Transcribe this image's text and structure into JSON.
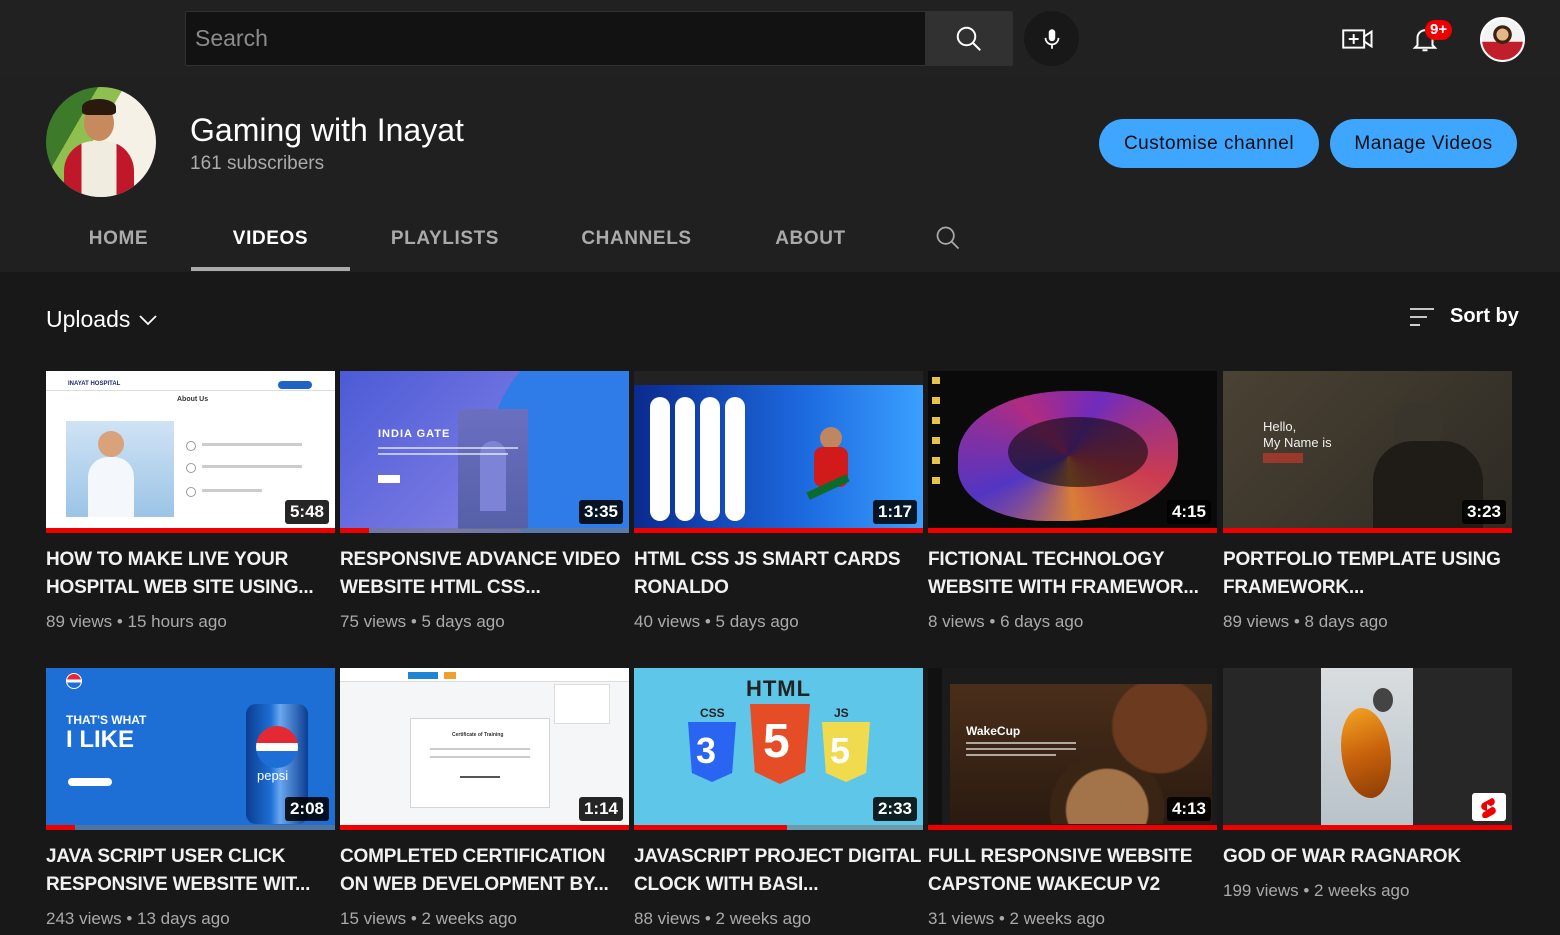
{
  "topbar": {
    "search_placeholder": "Search",
    "notification_count": "9+"
  },
  "channel": {
    "name": "Gaming with Inayat",
    "subscribers": "161 subscribers",
    "customise_label": "Customise channel",
    "manage_label": "Manage Videos"
  },
  "tabs": [
    "HOME",
    "VIDEOS",
    "PLAYLISTS",
    "CHANNELS",
    "ABOUT"
  ],
  "section": {
    "uploads_label": "Uploads",
    "sort_label": "Sort by"
  },
  "videos": [
    {
      "title": "HOW TO MAKE LIVE YOUR HOSPITAL WEB SITE USING...",
      "views": "89 views",
      "ago": "15 hours ago",
      "duration": "5:48",
      "watched": 1.0
    },
    {
      "title": "RESPONSIVE ADVANCE VIDEO WEBSITE HTML CSS...",
      "views": "75 views",
      "ago": "5 days ago",
      "duration": "3:35",
      "watched": 0.1
    },
    {
      "title": "HTML CSS JS SMART CARDS RONALDO",
      "views": "40 views",
      "ago": "5 days ago",
      "duration": "1:17",
      "watched": 1.0
    },
    {
      "title": "FICTIONAL TECHNOLOGY WEBSITE WITH FRAMEWOR...",
      "views": "8 views",
      "ago": "6 days ago",
      "duration": "4:15",
      "watched": 1.0
    },
    {
      "title": "PORTFOLIO TEMPLATE USING FRAMEWORK...",
      "views": "89 views",
      "ago": "8 days ago",
      "duration": "3:23",
      "watched": 1.0
    },
    {
      "title": "JAVA SCRIPT USER CLICK RESPONSIVE WEBSITE WIT...",
      "views": "243 views",
      "ago": "13 days ago",
      "duration": "2:08",
      "watched": 0.1
    },
    {
      "title": "COMPLETED CERTIFICATION ON WEB DEVELOPMENT BY...",
      "views": "15 views",
      "ago": "2 weeks ago",
      "duration": "1:14",
      "watched": 1.0
    },
    {
      "title": "JAVASCRIPT PROJECT DIGITAL CLOCK WITH BASI...",
      "views": "88 views",
      "ago": "2 weeks ago",
      "duration": "2:33",
      "watched": 0.53
    },
    {
      "title": "FULL RESPONSIVE WEBSITE CAPSTONE WAKECUP V2",
      "views": "31 views",
      "ago": "2 weeks ago",
      "duration": "4:13",
      "watched": 1.0
    },
    {
      "title": "GOD OF WAR RAGNAROK",
      "views": "199 views",
      "ago": "2 weeks ago",
      "duration": "",
      "watched": 1.0
    }
  ],
  "thumb_text": {
    "hospital_brand": "INAYAT HOSPITAL",
    "hospital_heading": "About Us",
    "india": "INDIA GATE",
    "portfolio_line1": "Hello,",
    "portfolio_line2": "My Name is",
    "pepsi_line1": "THAT'S WHAT",
    "pepsi_line2": "I LIKE",
    "pepsi_can": "pepsi",
    "cert_title": "Certificate of Training",
    "html_word": "HTML",
    "html_css": "CSS",
    "html_js": "JS",
    "wake_brand": "WakeCup"
  },
  "colors": {
    "accent_blue": "#3ea6ff",
    "progress_red": "#ee0000",
    "background": "#181818"
  }
}
